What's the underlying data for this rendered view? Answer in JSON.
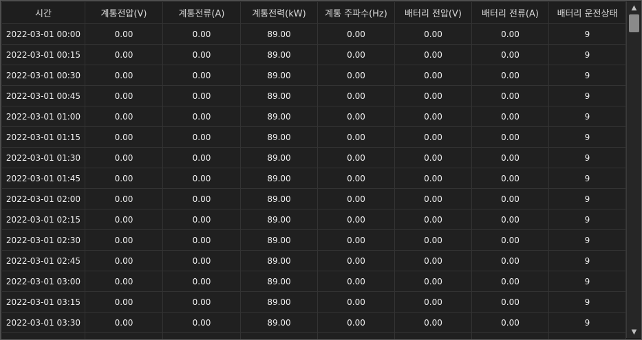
{
  "table": {
    "headers": [
      "시간",
      "계통전압(V)",
      "계통전류(A)",
      "계통전력(kW)",
      "계통 주파수(Hz)",
      "배터리 전압(V)",
      "배터리 전류(A)",
      "배터리 운전상태"
    ],
    "rows": [
      [
        "2022-03-01  00:00",
        "0.00",
        "0.00",
        "89.00",
        "0.00",
        "0.00",
        "0.00",
        "9"
      ],
      [
        "2022-03-01  00:15",
        "0.00",
        "0.00",
        "89.00",
        "0.00",
        "0.00",
        "0.00",
        "9"
      ],
      [
        "2022-03-01  00:30",
        "0.00",
        "0.00",
        "89.00",
        "0.00",
        "0.00",
        "0.00",
        "9"
      ],
      [
        "2022-03-01  00:45",
        "0.00",
        "0.00",
        "89.00",
        "0.00",
        "0.00",
        "0.00",
        "9"
      ],
      [
        "2022-03-01  01:00",
        "0.00",
        "0.00",
        "89.00",
        "0.00",
        "0.00",
        "0.00",
        "9"
      ],
      [
        "2022-03-01  01:15",
        "0.00",
        "0.00",
        "89.00",
        "0.00",
        "0.00",
        "0.00",
        "9"
      ],
      [
        "2022-03-01  01:30",
        "0.00",
        "0.00",
        "89.00",
        "0.00",
        "0.00",
        "0.00",
        "9"
      ],
      [
        "2022-03-01  01:45",
        "0.00",
        "0.00",
        "89.00",
        "0.00",
        "0.00",
        "0.00",
        "9"
      ],
      [
        "2022-03-01  02:00",
        "0.00",
        "0.00",
        "89.00",
        "0.00",
        "0.00",
        "0.00",
        "9"
      ],
      [
        "2022-03-01  02:15",
        "0.00",
        "0.00",
        "89.00",
        "0.00",
        "0.00",
        "0.00",
        "9"
      ],
      [
        "2022-03-01  02:30",
        "0.00",
        "0.00",
        "89.00",
        "0.00",
        "0.00",
        "0.00",
        "9"
      ],
      [
        "2022-03-01  02:45",
        "0.00",
        "0.00",
        "89.00",
        "0.00",
        "0.00",
        "0.00",
        "9"
      ],
      [
        "2022-03-01  03:00",
        "0.00",
        "0.00",
        "89.00",
        "0.00",
        "0.00",
        "0.00",
        "9"
      ],
      [
        "2022-03-01  03:15",
        "0.00",
        "0.00",
        "89.00",
        "0.00",
        "0.00",
        "0.00",
        "9"
      ],
      [
        "2022-03-01  03:30",
        "0.00",
        "0.00",
        "89.00",
        "0.00",
        "0.00",
        "0.00",
        "9"
      ],
      [
        "",
        "",
        "",
        "",
        "",
        "",
        "",
        ""
      ]
    ]
  },
  "scrollbar": {
    "up_icon": "chevron-up-icon",
    "down_icon": "chevron-down-icon",
    "up_glyph": "▲",
    "down_glyph": "▼"
  }
}
